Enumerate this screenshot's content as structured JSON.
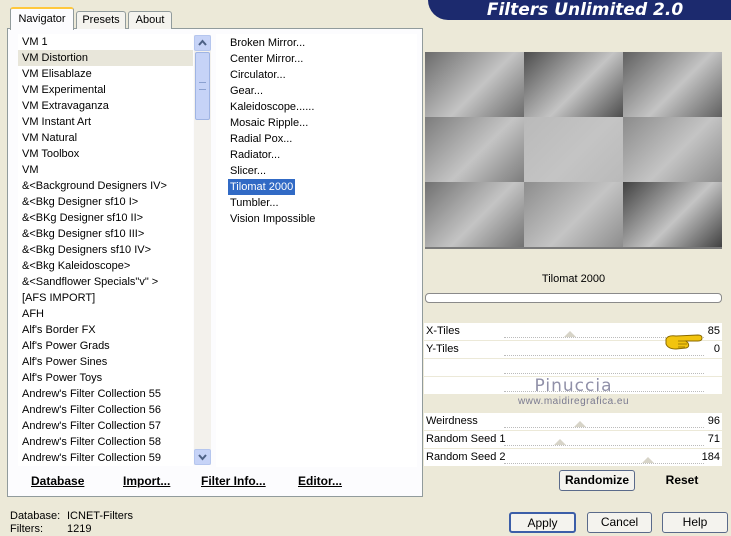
{
  "app": {
    "title": "Filters Unlimited 2.0"
  },
  "tabs": [
    {
      "label": "Navigator"
    },
    {
      "label": "Presets"
    },
    {
      "label": "About"
    }
  ],
  "categories": {
    "selected_index": 1,
    "items": [
      "VM 1",
      "VM Distortion",
      "VM Elisablaze",
      "VM Experimental",
      "VM Extravaganza",
      "VM Instant Art",
      "VM Natural",
      "VM Toolbox",
      "VM",
      "&<Background Designers IV>",
      "&<Bkg Designer sf10 I>",
      "&<BKg Designer sf10 II>",
      "&<Bkg Designer sf10 III>",
      "&<Bkg Designers sf10 IV>",
      "&<Bkg Kaleidoscope>",
      "&<Sandflower Specials\"v\" >",
      "[AFS IMPORT]",
      "AFH",
      "Alf's Border FX",
      "Alf's Power Grads",
      "Alf's Power Sines",
      "Alf's Power Toys",
      "Andrew's Filter Collection 55",
      "Andrew's Filter Collection 56",
      "Andrew's Filter Collection 57",
      "Andrew's Filter Collection 58",
      "Andrew's Filter Collection 59"
    ]
  },
  "filters": {
    "selected_index": 9,
    "items": [
      "Broken Mirror...",
      "Center Mirror...",
      "Circulator...",
      "Gear...",
      "Kaleidoscope......",
      "Mosaic Ripple...",
      "Radial Pox...",
      "Radiator...",
      "Slicer...",
      "Tilomat 2000",
      "Tumbler...",
      "Vision Impossible"
    ]
  },
  "bottom_links": {
    "database": "Database",
    "import": "Import...",
    "filter_info": "Filter Info...",
    "editor": "Editor..."
  },
  "preview": {
    "filter_name": "Tilomat 2000",
    "tile_shades": [
      "#6a6a6a",
      "#4a4a4a",
      "#5e5e5e",
      "#7c7c7c",
      "#bdbdbd",
      "#8c8c8c",
      "#707070",
      "#8e8e8e",
      "#3e3e3e"
    ]
  },
  "params": [
    {
      "label": "X-Tiles",
      "value": "85",
      "level": 0.33
    },
    {
      "label": "Y-Tiles",
      "value": "0",
      "level": null
    },
    {
      "label": "",
      "value": "",
      "level": null
    },
    {
      "label": "",
      "value": "",
      "level": null
    },
    {
      "label": "Weirdness",
      "value": "96",
      "level": 0.38
    },
    {
      "label": "Random Seed 1",
      "value": "71",
      "level": 0.28
    },
    {
      "label": "Random Seed 2",
      "value": "184",
      "level": 0.72
    }
  ],
  "watermark": {
    "line1": "Pinuccia",
    "line2": "www.maidiregrafica.eu"
  },
  "buttons": {
    "randomize": "Randomize",
    "reset": "Reset",
    "apply": "Apply",
    "cancel": "Cancel",
    "help": "Help"
  },
  "status": {
    "database_label": "Database:",
    "database_value": "ICNET-Filters",
    "filters_label": "Filters:",
    "filters_value": "1219"
  },
  "colors": {
    "banner": "#1c2a6e",
    "selection": "#316ac5"
  }
}
